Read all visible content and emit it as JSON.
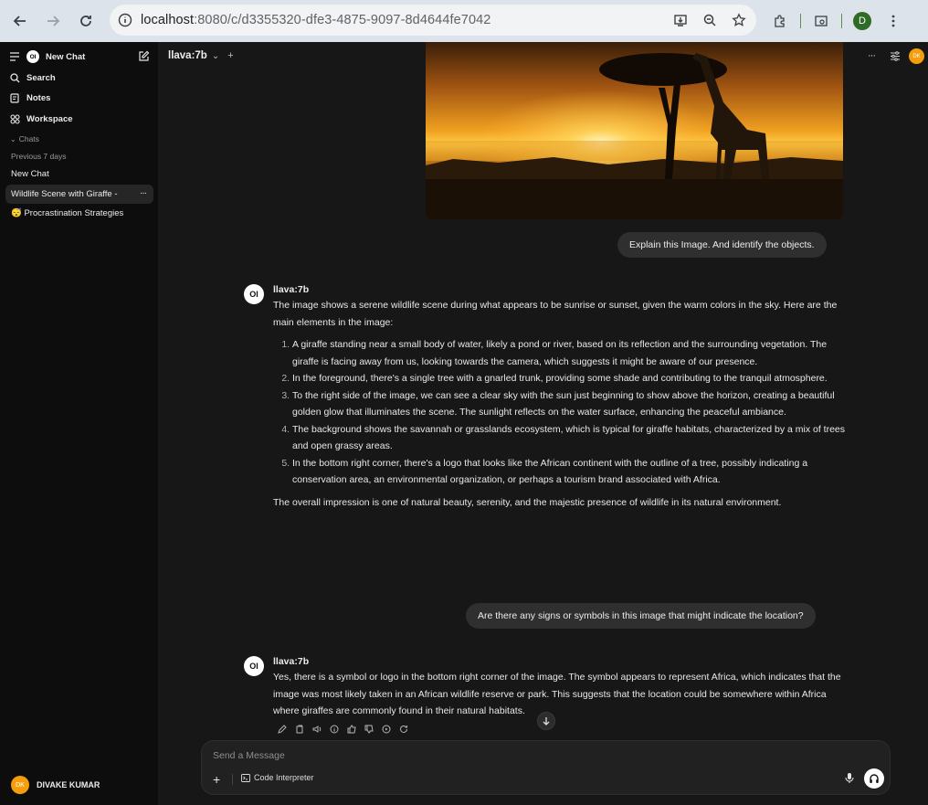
{
  "browser": {
    "url_host": "localhost",
    "url_rest": ":8080/c/d3355320-dfe3-4875-9097-8d4644fe7042",
    "profile_initial": "D"
  },
  "sidebar": {
    "logo_text": "OI",
    "new_chat": "New Chat",
    "search": "Search",
    "notes": "Notes",
    "workspace": "Workspace",
    "chats_label": "Chats",
    "section_label": "Previous 7 days",
    "chats": [
      "New Chat",
      "Wildlife Scene with Giraffe - ",
      "😴 Procrastination Strategies"
    ],
    "user_initials": "DK",
    "user_name": "DIVAKE KUMAR"
  },
  "topbar": {
    "model": "llava:7b",
    "avatar": "DK"
  },
  "conversation": {
    "user_msg_1": "Explain this Image. And identify the objects.",
    "bot_name": "llava:7b",
    "bot_logo": "OI",
    "bot_intro": "The image shows a serene wildlife scene during what appears to be sunrise or sunset, given the warm colors in the sky. Here are the main elements in the image:",
    "bot_items": [
      "A giraffe standing near a small body of water, likely a pond or river, based on its reflection and the surrounding vegetation. The giraffe is facing away from us, looking towards the camera, which suggests it might be aware of our presence.",
      "In the foreground, there's a single tree with a gnarled trunk, providing some shade and contributing to the tranquil atmosphere.",
      "To the right side of the image, we can see a clear sky with the sun just beginning to show above the horizon, creating a beautiful golden glow that illuminates the scene. The sunlight reflects on the water surface, enhancing the peaceful ambiance.",
      "The background shows the savannah or grasslands ecosystem, which is typical for giraffe habitats, characterized by a mix of trees and open grassy areas.",
      "In the bottom right corner, there's a logo that looks like the African continent with the outline of a tree, possibly indicating a conservation area, an environmental organization, or perhaps a tourism brand associated with Africa."
    ],
    "bot_outro": "The overall impression is one of natural beauty, serenity, and the majestic presence of wildlife in its natural environment.",
    "user_msg_2": "Are there any signs or symbols in this image that might indicate the location?",
    "bot_reply_2": "Yes, there is a symbol or logo in the bottom right corner of the image. The symbol appears to represent Africa, which indicates that the image was most likely taken in an African wildlife reserve or park. This suggests that the location could be somewhere within Africa where giraffes are commonly found in their natural habitats."
  },
  "composer": {
    "placeholder": "Send a Message",
    "code_interpreter": "Code Interpreter"
  },
  "colors": {
    "sidebar_bg": "#0d0d0d",
    "main_bg": "#171717",
    "bubble_bg": "#2f2f2f",
    "avatar_orange": "#f59e0b"
  }
}
